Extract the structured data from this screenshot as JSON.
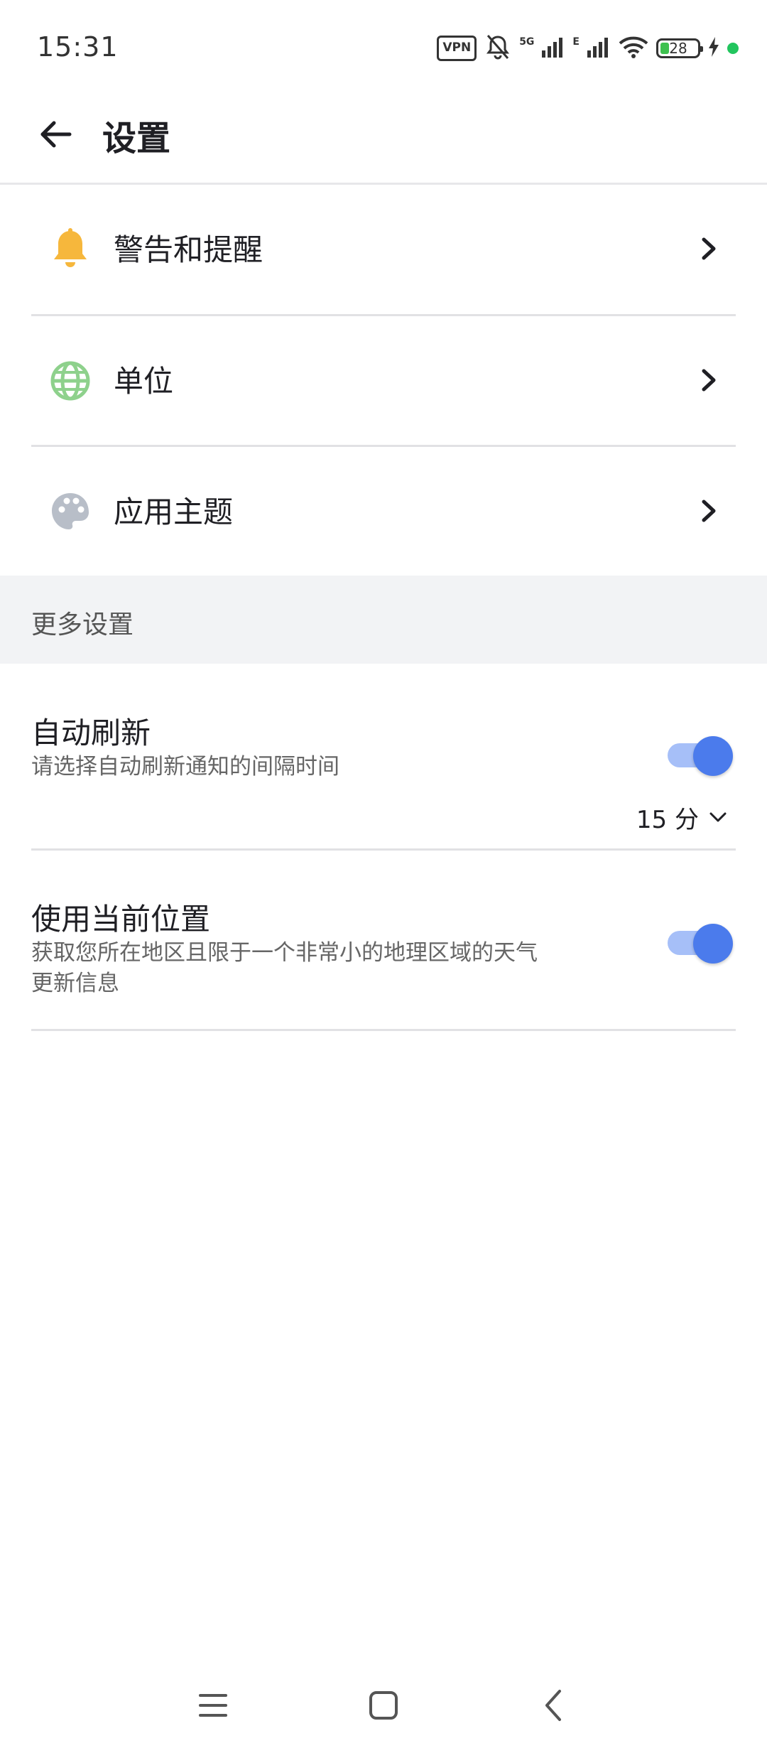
{
  "status_bar": {
    "time": "15:31",
    "vpn_label": "VPN",
    "network_5g": "5G",
    "network_e": "E",
    "battery_level": "28"
  },
  "header": {
    "title": "设置"
  },
  "menu": [
    {
      "label": "警告和提醒",
      "icon": "bell-icon",
      "icon_color": "#f6b73c"
    },
    {
      "label": "单位",
      "icon": "globe-icon",
      "icon_color": "#8ed18c"
    },
    {
      "label": "应用主题",
      "icon": "palette-icon",
      "icon_color": "#b8bec8"
    }
  ],
  "more_settings": {
    "section_title": "更多设置",
    "auto_refresh": {
      "title": "自动刷新",
      "description": "请选择自动刷新通知的间隔时间",
      "enabled": true,
      "interval": "15 分"
    },
    "current_location": {
      "title": "使用当前位置",
      "description_line1": "获取您所在地区且限于一个非常小的地理区域的天气",
      "description_line2": "更新信息",
      "enabled": true
    }
  },
  "colors": {
    "accent": "#4b7bec",
    "accent_track": "#a6bff8",
    "section_bg": "#f2f3f5"
  }
}
